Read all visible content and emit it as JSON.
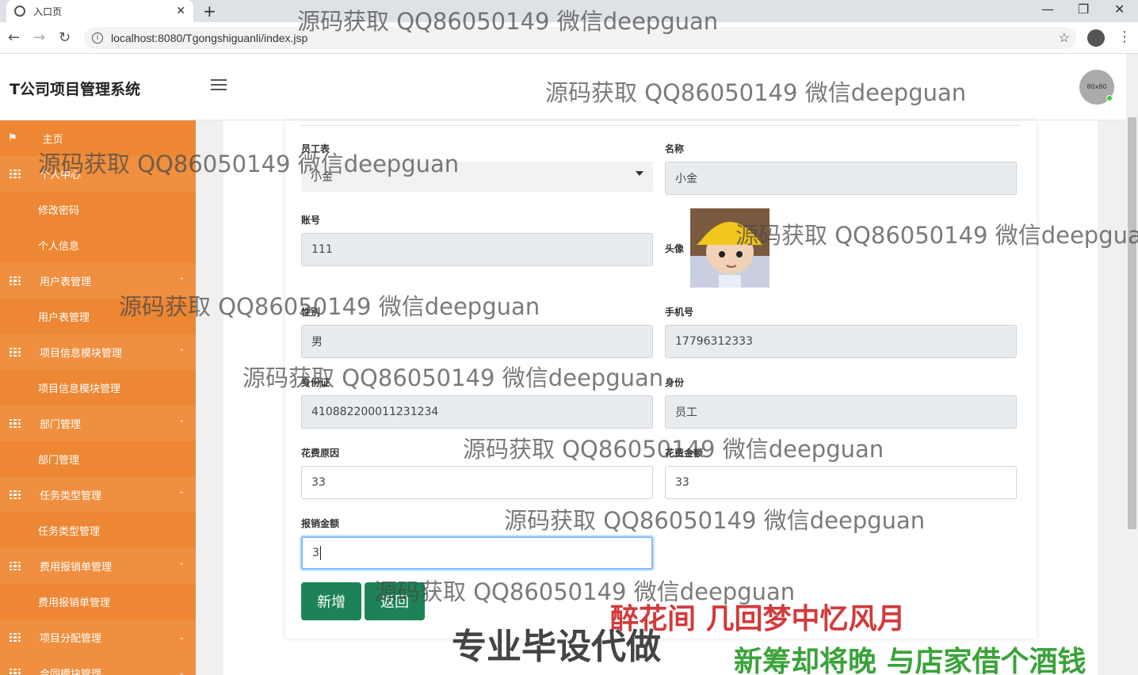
{
  "browser": {
    "tab_title": "入口页",
    "tab_close": "✕",
    "new_tab": "+",
    "url": "localhost:8080/Tgongshiguanli/index.jsp",
    "win_min": "—",
    "win_max": "❐",
    "win_close": "✕"
  },
  "header": {
    "title": "T公司项目管理系统",
    "avatar_text": "80x80"
  },
  "sidebar": {
    "items": [
      {
        "label": "主页",
        "type": "home"
      },
      {
        "label": "个人中心",
        "type": "parent",
        "caret": "⌃"
      },
      {
        "label": "修改密码",
        "type": "child"
      },
      {
        "label": "个人信息",
        "type": "child"
      },
      {
        "label": "用户表管理",
        "type": "parent",
        "caret": "⌃"
      },
      {
        "label": "用户表管理",
        "type": "child"
      },
      {
        "label": "项目信息模块管理",
        "type": "parent",
        "caret": "⌃"
      },
      {
        "label": "项目信息模块管理",
        "type": "child"
      },
      {
        "label": "部门管理",
        "type": "parent",
        "caret": "⌃"
      },
      {
        "label": "部门管理",
        "type": "child"
      },
      {
        "label": "任务类型管理",
        "type": "parent",
        "caret": "⌃"
      },
      {
        "label": "任务类型管理",
        "type": "child"
      },
      {
        "label": "费用报销单管理",
        "type": "parent",
        "caret": "⌃"
      },
      {
        "label": "费用报销单管理",
        "type": "child"
      },
      {
        "label": "项目分配管理",
        "type": "parent",
        "caret": "⌄"
      },
      {
        "label": "合同模块管理",
        "type": "parent",
        "caret": "⌄"
      }
    ]
  },
  "form": {
    "employee_label": "员工表",
    "employee_value": "小金",
    "name_label": "名称",
    "name_value": "小金",
    "account_label": "账号",
    "account_value": "111",
    "avatar_label": "头像",
    "gender_label": "性别",
    "gender_value": "男",
    "phone_label": "手机号",
    "phone_value": "17796312333",
    "idcard_label": "身份证",
    "idcard_value": "410882200011231234",
    "role_label": "身份",
    "role_value": "员工",
    "reason_label": "花费原因",
    "reason_value": "33",
    "cost_label": "花费金额",
    "cost_value": "33",
    "reimburse_label": "报销金额",
    "reimburse_value": "3",
    "add_button": "新增",
    "back_button": "返回"
  },
  "watermarks": {
    "text": "源码获取 QQ86050149 微信deepguan",
    "caption1": "醉花间 几回梦中忆风月",
    "caption2": "专业毕设代做",
    "caption3": "新筹却将晚 与店家借个酒钱"
  },
  "colors": {
    "sidebar": "#ed8733",
    "button": "#1d8356",
    "focus": "#80bdff"
  }
}
